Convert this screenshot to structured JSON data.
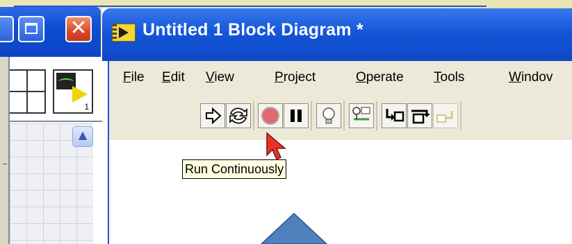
{
  "front_panel": {
    "palette_number": "1"
  },
  "block_diagram": {
    "title": "Untitled 1 Block Diagram *"
  },
  "menu": [
    {
      "pre": "",
      "ul": "F",
      "post": "ile"
    },
    {
      "pre": "",
      "ul": "E",
      "post": "dit"
    },
    {
      "pre": "",
      "ul": "V",
      "post": "iew"
    },
    {
      "pre": "",
      "ul": "P",
      "post": "roject"
    },
    {
      "pre": "",
      "ul": "O",
      "post": "perate"
    },
    {
      "pre": "",
      "ul": "T",
      "post": "ools"
    },
    {
      "pre": "",
      "ul": "W",
      "post": "indov"
    }
  ],
  "toolbar": {
    "buttons": [
      "run",
      "run-continuously",
      "abort-execution",
      "pause",
      "highlight-execution",
      "retain-wire-values",
      "step-into",
      "step-over",
      "step-out"
    ]
  },
  "tooltip": {
    "text": "Run Continuously"
  },
  "colors": {
    "title_bar": "#1456d7",
    "close_button": "#d6492b",
    "tooltip_bg": "#ffffe1",
    "callout_arrow": "#4f81bd"
  }
}
